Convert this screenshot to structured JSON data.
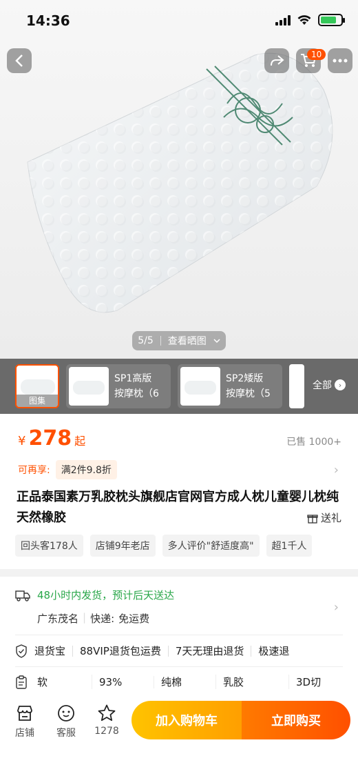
{
  "status": {
    "time": "14:36"
  },
  "nav": {
    "cart_count": "10"
  },
  "gallery": {
    "counter": "5/5",
    "view_label": "查看晒图"
  },
  "thumbs": {
    "first_caption": "图集",
    "items": [
      {
        "line1": "SP1高版",
        "line2": "按摩枕（6"
      },
      {
        "line1": "SP2矮版",
        "line2": "按摩枕（5"
      }
    ],
    "all_label": "全部"
  },
  "price": {
    "currency": "¥",
    "value": "278",
    "suffix": "起",
    "sold": "已售 1000+"
  },
  "promo": {
    "label": "可再享:",
    "tag": "满2件9.8折"
  },
  "product": {
    "title": "正品泰国素万乳胶枕头旗舰店官网官方成人枕儿童婴儿枕纯天然橡胶",
    "gift_label": "送礼"
  },
  "tags": [
    "回头客178人",
    "店铺9年老店",
    "多人评价\"舒适度高\"",
    "超1千人"
  ],
  "shipping": {
    "headline": "48小时内发货，预计后天送达",
    "origin": "广东茂名",
    "express_label": "快递:",
    "express_value": "免运费"
  },
  "guarantees": [
    "退货宝",
    "88VIP退货包运费",
    "7天无理由退货",
    "极速退"
  ],
  "params": [
    "软",
    "93%",
    "纯棉",
    "乳胶",
    "3D切"
  ],
  "bottom": {
    "shop_label": "店铺",
    "service_label": "客服",
    "fav_count": "1278",
    "add_cart": "加入购物车",
    "buy_now": "立即购买"
  },
  "colors": {
    "accent": "#ff5000",
    "ship_green": "#2aa74a",
    "cart_button": "#ffb000"
  }
}
